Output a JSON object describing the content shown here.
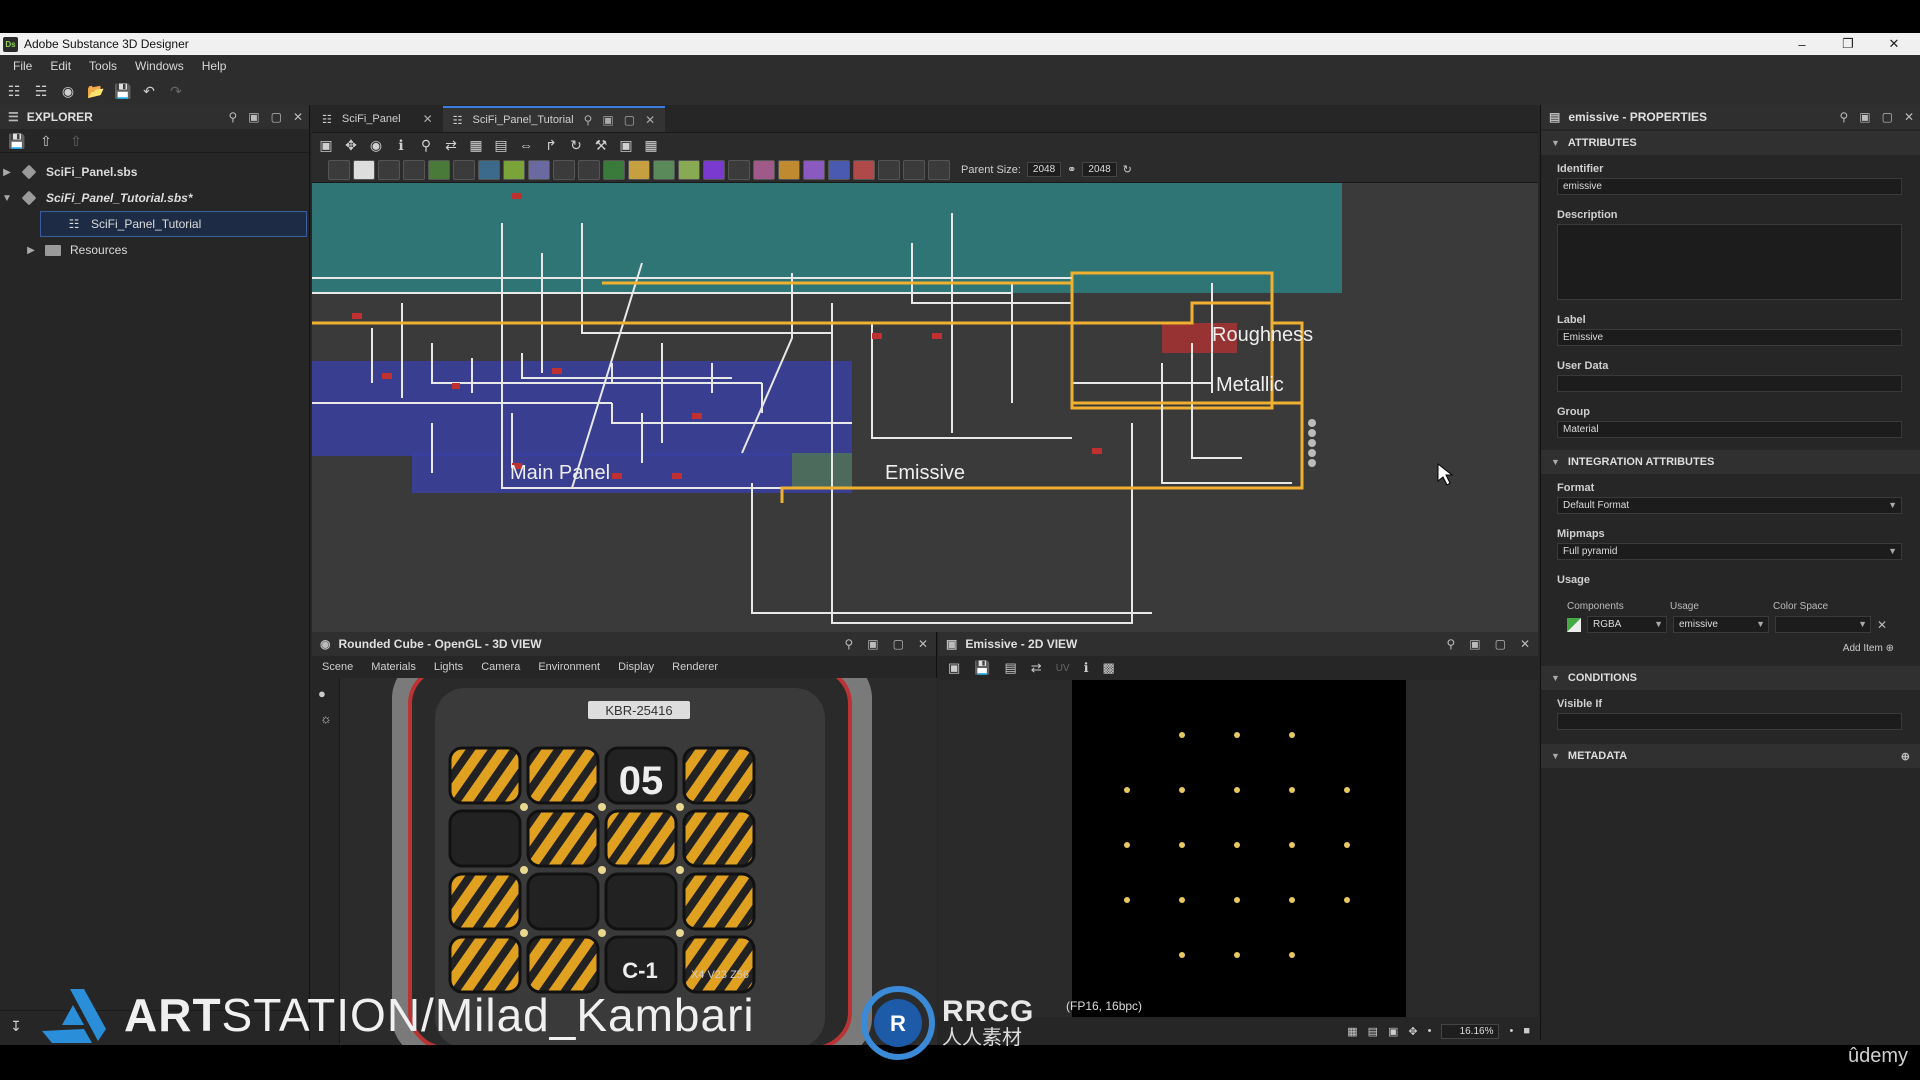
{
  "app": {
    "title": "Adobe Substance 3D Designer",
    "logo": "Ds"
  },
  "menu": [
    "File",
    "Edit",
    "Tools",
    "Windows",
    "Help"
  ],
  "explorer": {
    "title": "EXPLORER",
    "items": [
      {
        "label": "SciFi_Panel.sbs"
      },
      {
        "label": "SciFi_Panel_Tutorial.sbs*"
      },
      {
        "label": "SciFi_Panel_Tutorial"
      },
      {
        "label": "Resources"
      }
    ]
  },
  "graph": {
    "tabs": [
      {
        "label": "SciFi_Panel"
      },
      {
        "label": "SciFi_Panel_Tutorial"
      }
    ],
    "parent_size_label": "Parent Size:",
    "parent_size": "2048",
    "size": "2048",
    "frames": {
      "roughness": "Roughness",
      "metallic": "Metallic",
      "main_panel": "Main Panel",
      "emissive": "Emissive"
    }
  },
  "properties": {
    "title": "emissive - PROPERTIES",
    "sections": {
      "attributes": "ATTRIBUTES",
      "integration": "INTEGRATION ATTRIBUTES",
      "conditions": "CONDITIONS",
      "metadata": "METADATA"
    },
    "identifier_label": "Identifier",
    "identifier": "emissive",
    "description_label": "Description",
    "label_label": "Label",
    "label": "Emissive",
    "userdata_label": "User Data",
    "group_label": "Group",
    "group": "Material",
    "format_label": "Format",
    "format": "Default Format",
    "mipmaps_label": "Mipmaps",
    "mipmaps": "Full pyramid",
    "usage_label": "Usage",
    "usage_cols": [
      "Components",
      "Usage",
      "Color Space"
    ],
    "usage_row": {
      "components": "RGBA",
      "usage": "emissive",
      "colorspace": ""
    },
    "add_item": "Add Item",
    "visible_if_label": "Visible If"
  },
  "view3d": {
    "title": "Rounded Cube - OpenGL - 3D VIEW",
    "menu": [
      "Scene",
      "Materials",
      "Lights",
      "Camera",
      "Environment",
      "Display",
      "Renderer"
    ],
    "label_plate": "KBR-25416",
    "number": "05",
    "code": "C-1",
    "code2": "X4 V23 Z56"
  },
  "view2d": {
    "title": "Emissive - 2D VIEW",
    "info": "(FP16, 16bpc)",
    "zoom": "16.16%"
  },
  "watermark": {
    "bold": "ART",
    "rest": "STATION/Milad_Kambari",
    "rrcg": "RRCG",
    "rrcg_sub": "人人素材"
  },
  "udemy": "ûdemy"
}
